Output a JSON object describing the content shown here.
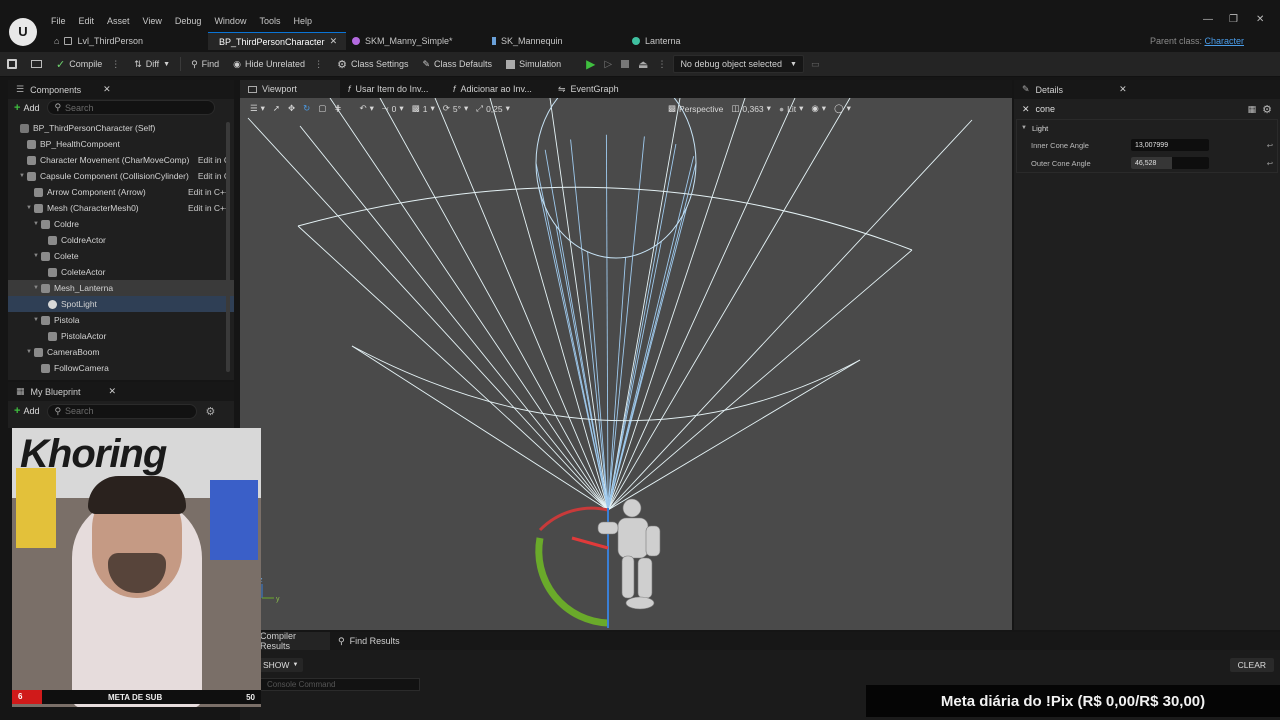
{
  "menu": [
    "File",
    "Edit",
    "Asset",
    "View",
    "Debug",
    "Window",
    "Tools",
    "Help"
  ],
  "logo_text": "U",
  "tabs": [
    {
      "label": "Lvl_ThirdPerson",
      "active": false
    },
    {
      "label": "BP_ThirdPersonCharacter",
      "active": true
    },
    {
      "label": "SKM_Manny_Simple*",
      "active": false
    },
    {
      "label": "SK_Mannequin",
      "active": false
    },
    {
      "label": "Lanterna",
      "active": false
    }
  ],
  "parent_class": {
    "label": "Parent class:",
    "value": "Character"
  },
  "toolbar": {
    "compile": "Compile",
    "diff": "Diff",
    "find": "Find",
    "hide_unrelated": "Hide Unrelated",
    "class_settings": "Class Settings",
    "class_defaults": "Class Defaults",
    "simulation": "Simulation",
    "debug_select": "No debug object selected"
  },
  "components": {
    "title": "Components",
    "add": "Add",
    "search_placeholder": "Search",
    "edit_cpp": "Edit in C++",
    "edit_cpp_short": "Edit in C",
    "items": [
      {
        "label": "BP_ThirdPersonCharacter (Self)",
        "indent": 0
      },
      {
        "label": "BP_HealthCompoent",
        "indent": 1
      },
      {
        "label": "Character Movement (CharMoveComp)",
        "indent": 1
      },
      {
        "label": "Capsule Component (CollisionCylinder)",
        "indent": 1
      },
      {
        "label": "Arrow Component (Arrow)",
        "indent": 2
      },
      {
        "label": "Mesh (CharacterMesh0)",
        "indent": 2
      },
      {
        "label": "Coldre",
        "indent": 3
      },
      {
        "label": "ColdreActor",
        "indent": 4
      },
      {
        "label": "Colete",
        "indent": 3
      },
      {
        "label": "ColeteActor",
        "indent": 4
      },
      {
        "label": "Mesh_Lanterna",
        "indent": 3
      },
      {
        "label": "SpotLight",
        "indent": 4
      },
      {
        "label": "Pistola",
        "indent": 3
      },
      {
        "label": "PistolaActor",
        "indent": 4
      },
      {
        "label": "CameraBoom",
        "indent": 2
      },
      {
        "label": "FollowCamera",
        "indent": 3
      }
    ]
  },
  "my_blueprint": {
    "title": "My Blueprint",
    "add": "Add",
    "search_placeholder": "Search"
  },
  "viewport_tabs": [
    "Viewport",
    "Usar Item do Inv...",
    "Adicionar ao Inv...",
    "EventGraph"
  ],
  "viewport_toolbar": {
    "grid_snap": "0",
    "rot_value": "1",
    "rot_snap": "5°",
    "scale_snap": "0,25",
    "perspective": "Perspective",
    "fov": "0,363",
    "lit": "Lit"
  },
  "details": {
    "title": "Details",
    "search_value": "cone",
    "category": "Light",
    "props": [
      {
        "label": "Inner Cone Angle",
        "value": "13,007999",
        "fill": 0.0
      },
      {
        "label": "Outer Cone Angle",
        "value": "46,528",
        "fill": 0.52
      }
    ]
  },
  "bottom": {
    "compiler_results": "Compiler Results",
    "find_results": "Find Results",
    "show": "SHOW",
    "clear": "CLEAR",
    "console_placeholder": "Console Command"
  },
  "stream": {
    "overlay_name": "Khoring",
    "sub_label": "META DE SUB",
    "sub_current": "6",
    "sub_goal": "50",
    "donation_text": "Meta diária do !Pix (R$ 0,00/R$ 30,00)"
  },
  "colors": {
    "accent": "#0a74d6",
    "play": "#3fbf3f",
    "selected": "#2f3f55"
  }
}
